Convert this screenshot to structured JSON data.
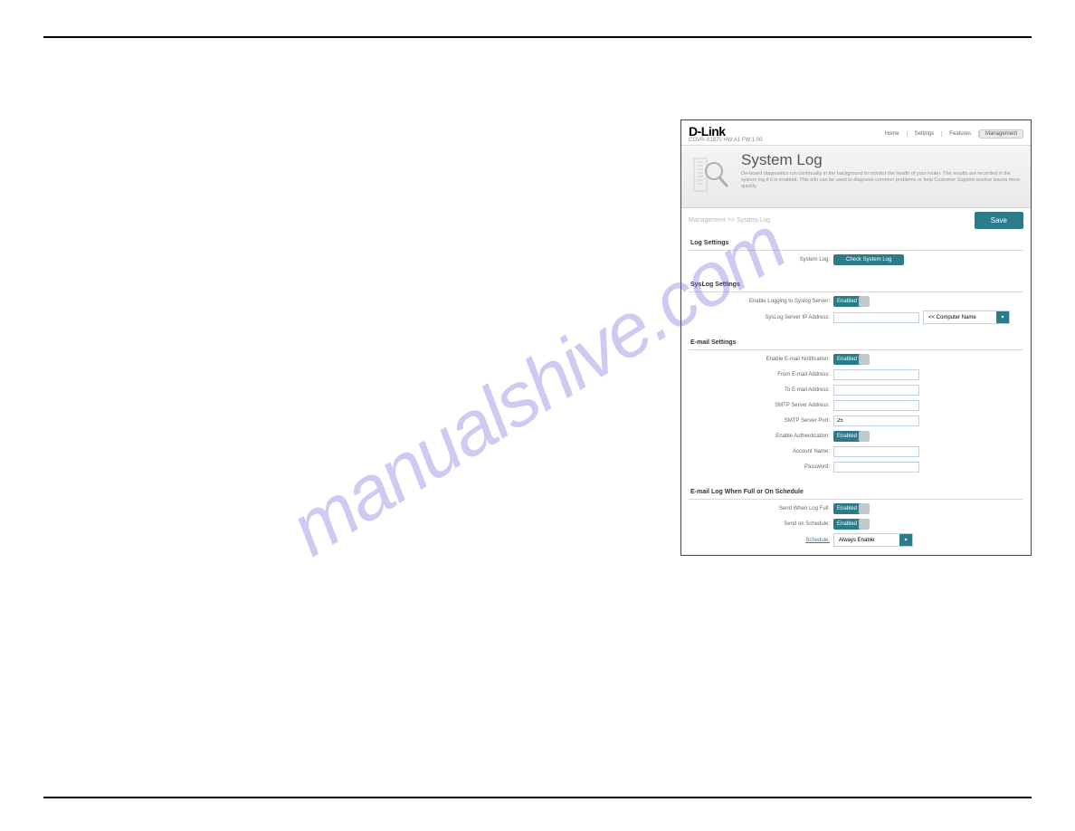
{
  "watermark": "manualshive.com",
  "brand": {
    "name": "D-Link",
    "model": "COVR-X1870  HW:A1  FW:1.00"
  },
  "nav": {
    "items": [
      {
        "label": "Home"
      },
      {
        "label": "Settings"
      },
      {
        "label": "Features"
      },
      {
        "label": "Management"
      }
    ]
  },
  "intro": {
    "title": "System Log",
    "desc": "On-board diagnostics run continually in the background to monitor the health of your router. The results are recorded in the system log if it is enabled. This info can be used to diagnose common problems or help Customer Support resolve issues more quickly."
  },
  "breadcrumb": "Management >> System Log",
  "save_label": "Save",
  "sections": {
    "log_settings": {
      "title": "Log Settings",
      "system_log_label": "System Log:",
      "check_btn": "Check System Log"
    },
    "syslog_settings": {
      "title": "SysLog Settings",
      "enable_label": "Enable Logging to Syslog Server:",
      "enable_value": "Enabled",
      "server_ip_label": "SysLog Server IP Address:",
      "server_ip_value": "",
      "computer_name_label": "<< Computer Name"
    },
    "email_settings": {
      "title": "E-mail Settings",
      "enable_label": "Enable E-mail Notification:",
      "enable_value": "Enabled",
      "from_label": "From E-mail Address:",
      "from_value": "",
      "to_label": "To E-mail Address:",
      "to_value": "",
      "smtp_addr_label": "SMTP Server Address:",
      "smtp_addr_value": "",
      "smtp_port_label": "SMTP Server Port:",
      "smtp_port_value": "25",
      "auth_label": "Enable Authentication:",
      "auth_value": "Enabled",
      "account_label": "Account Name:",
      "account_value": "",
      "password_label": "Password:",
      "password_value": ""
    },
    "email_log": {
      "title": "E-mail Log When Full or On Schedule",
      "send_full_label": "Send When Log Full:",
      "send_full_value": "Enabled",
      "send_sched_label": "Send on Schedule:",
      "send_sched_value": "Enabled",
      "schedule_label": "Schedule:",
      "schedule_value": "Always Enable"
    }
  }
}
